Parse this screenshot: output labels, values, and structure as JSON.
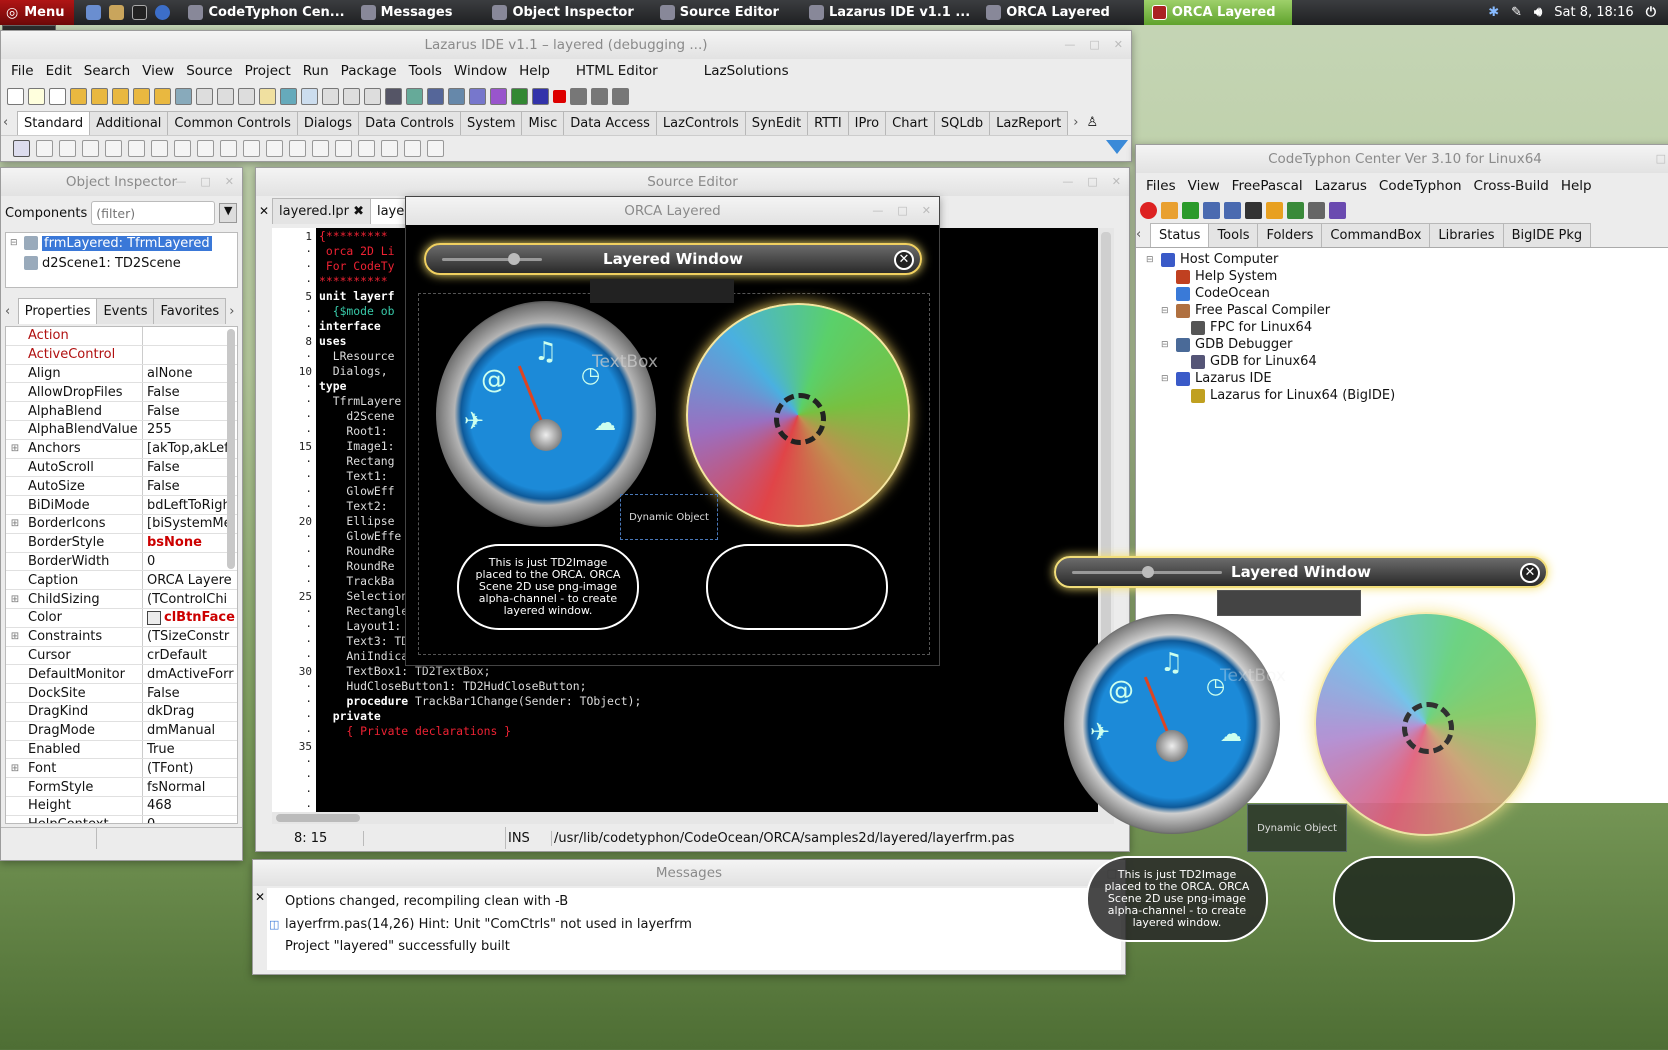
{
  "taskbar": {
    "menu_label": "Menu",
    "tasks": [
      "CodeTyphon Cen...",
      "Messages",
      "Object Inspector",
      "Source Editor",
      "Lazarus IDE v1.1 ...",
      "ORCA Layered",
      "ORCA Layered"
    ],
    "clock": "Sat  8, 18:16"
  },
  "menu_tooltip": "Menu",
  "ide": {
    "title": "Lazarus IDE v1.1 – layered (debugging ...)",
    "menu": [
      "File",
      "Edit",
      "Search",
      "View",
      "Source",
      "Project",
      "Run",
      "Package",
      "Tools",
      "Window",
      "Help",
      "HTML Editor",
      "LazSolutions"
    ],
    "palette_tabs": [
      "Standard",
      "Additional",
      "Common Controls",
      "Dialogs",
      "Data Controls",
      "System",
      "Misc",
      "Data Access",
      "LazControls",
      "SynEdit",
      "RTTI",
      "IPro",
      "Chart",
      "SQLdb",
      "LazReport"
    ]
  },
  "inspector": {
    "title": "Object Inspector",
    "components_label": "Components",
    "filter_placeholder": "(filter)",
    "tree": [
      "frmLayered: TfrmLayered",
      "d2Scene1: TD2Scene"
    ],
    "tabs": [
      "Properties",
      "Events",
      "Favorites"
    ],
    "properties": [
      {
        "name": "Action",
        "value": "",
        "red": true
      },
      {
        "name": "ActiveControl",
        "value": "",
        "red": true
      },
      {
        "name": "Align",
        "value": "alNone"
      },
      {
        "name": "AllowDropFiles",
        "value": "False"
      },
      {
        "name": "AlphaBlend",
        "value": "False"
      },
      {
        "name": "AlphaBlendValue",
        "value": "255"
      },
      {
        "name": "Anchors",
        "value": "[akTop,akLeft",
        "expand": true
      },
      {
        "name": "AutoScroll",
        "value": "False"
      },
      {
        "name": "AutoSize",
        "value": "False"
      },
      {
        "name": "BiDiMode",
        "value": "bdLeftToRigh"
      },
      {
        "name": "BorderIcons",
        "value": "[biSystemMe",
        "expand": true
      },
      {
        "name": "BorderStyle",
        "value": "bsNone",
        "boldred": true
      },
      {
        "name": "BorderWidth",
        "value": "0"
      },
      {
        "name": "Caption",
        "value": "ORCA Layere"
      },
      {
        "name": "ChildSizing",
        "value": "(TControlChi",
        "expand": true
      },
      {
        "name": "Color",
        "value": "clBtnFace",
        "boldred": true,
        "swatch": true
      },
      {
        "name": "Constraints",
        "value": "(TSizeConstr",
        "expand": true
      },
      {
        "name": "Cursor",
        "value": "crDefault"
      },
      {
        "name": "DefaultMonitor",
        "value": "dmActiveForr"
      },
      {
        "name": "DockSite",
        "value": "False"
      },
      {
        "name": "DragKind",
        "value": "dkDrag"
      },
      {
        "name": "DragMode",
        "value": "dmManual"
      },
      {
        "name": "Enabled",
        "value": "True"
      },
      {
        "name": "Font",
        "value": "(TFont)",
        "expand": true
      },
      {
        "name": "FormStyle",
        "value": "fsNormal"
      },
      {
        "name": "Height",
        "value": "468"
      },
      {
        "name": "HelpContext",
        "value": "0"
      }
    ]
  },
  "source_editor": {
    "title": "Source Editor",
    "tabs": [
      "layered.lpr",
      "laye"
    ],
    "gutter": [
      "1",
      "·",
      "·",
      "·",
      "5",
      "·",
      "·",
      "8",
      "·",
      "10",
      "·",
      "·",
      "·",
      "·",
      "15",
      "·",
      "·",
      "·",
      "·",
      "20",
      "·",
      "·",
      "·",
      "·",
      "25",
      "·",
      "·",
      "·",
      "·",
      "30",
      "·",
      "·",
      "·",
      "·",
      "35",
      "·",
      "·",
      "·",
      "·"
    ],
    "status_pos": "8: 15",
    "status_mode": "INS",
    "status_file": "/usr/lib/codetyphon/CodeOcean/ORCA/samples2d/layered/layerfrm.pas"
  },
  "code_lines": [
    {
      "t": "{*********",
      "c": "rd"
    },
    {
      "t": " orca 2D Li",
      "c": "rd"
    },
    {
      "t": " For CodeTy",
      "c": "rd"
    },
    {
      "t": "**********",
      "c": "rd"
    },
    {
      "t": "",
      "c": ""
    },
    {
      "t": "unit layerf",
      "c": "kw"
    },
    {
      "t": "",
      "c": ""
    },
    {
      "t": "  {$mode ob",
      "c": "cm"
    },
    {
      "t": "",
      "c": ""
    },
    {
      "t": "interface",
      "c": "kw"
    },
    {
      "t": "",
      "c": ""
    },
    {
      "t": "uses",
      "c": "kw"
    },
    {
      "t": "  LResource",
      "c": ""
    },
    {
      "t": "  Dialogs, ",
      "c": ""
    },
    {
      "t": "",
      "c": ""
    },
    {
      "t": "type",
      "c": "kw"
    },
    {
      "t": "  TfrmLayere",
      "c": ""
    },
    {
      "t": "    d2Scene",
      "c": ""
    },
    {
      "t": "    Root1:",
      "c": ""
    },
    {
      "t": "    Image1:",
      "c": ""
    },
    {
      "t": "    Rectang",
      "c": ""
    },
    {
      "t": "    Text1:",
      "c": ""
    },
    {
      "t": "    GlowEff",
      "c": ""
    },
    {
      "t": "    Text2:",
      "c": ""
    },
    {
      "t": "    Ellipse",
      "c": ""
    },
    {
      "t": "    GlowEffe",
      "c": ""
    },
    {
      "t": "    RoundRe",
      "c": ""
    },
    {
      "t": "    RoundRe",
      "c": ""
    },
    {
      "t": "    TrackBa",
      "c": ""
    },
    {
      "t": "    Selection1: TD2Selection;",
      "c": ""
    },
    {
      "t": "    Rectangle2: TD2Rectangle;",
      "c": ""
    },
    {
      "t": "    Layout1: TD2Layout;",
      "c": ""
    },
    {
      "t": "    Text3: TD2Text;",
      "c": ""
    },
    {
      "t": "    AniIndicator1: TD2AniIndicator;",
      "c": ""
    },
    {
      "t": "    TextBox1: TD2TextBox;",
      "c": ""
    },
    {
      "t": "    HudCloseButton1: TD2HudCloseButton;",
      "c": ""
    },
    {
      "t": "    procedure TrackBar1Change(Sender: TObject);",
      "c": "proc"
    },
    {
      "t": "  private",
      "c": "kw"
    },
    {
      "t": "    { Private declarations }",
      "c": "rd"
    }
  ],
  "orca": {
    "title": "ORCA Layered",
    "hud_title": "Layered Window",
    "textbox_label": "TextBox",
    "dynamic_label": "Dynamic Object",
    "info_text": "This is just TD2Image placed to the ORCA. ORCA Scene 2D use png-image alpha-channel - to create layered window.",
    "close_glyph": "✕"
  },
  "center": {
    "title": "CodeTyphon Center Ver 3.10 for Linux64",
    "menu": [
      "Files",
      "View",
      "FreePascal",
      "Lazarus",
      "CodeTyphon",
      "Cross-Build",
      "Help"
    ],
    "tabs": [
      "Status",
      "Tools",
      "Folders",
      "CommandBox",
      "Libraries",
      "BigIDE Pkg"
    ],
    "tree": [
      {
        "label": "Host Computer",
        "level": 0
      },
      {
        "label": "Help System",
        "level": 1
      },
      {
        "label": "CodeOcean",
        "level": 1
      },
      {
        "label": "Free Pascal Compiler",
        "level": 1
      },
      {
        "label": "FPC for Linux64",
        "level": 2
      },
      {
        "label": "GDB Debugger",
        "level": 1
      },
      {
        "label": "GDB for Linux64",
        "level": 2
      },
      {
        "label": "Lazarus IDE",
        "level": 1
      },
      {
        "label": "Lazarus for Linux64 (BigIDE)",
        "level": 2
      }
    ]
  },
  "messages": {
    "title": "Messages",
    "lines": [
      "Options changed, recompiling clean with -B",
      "layerfrm.pas(14,26) Hint: Unit \"ComCtrls\" not used in layerfrm",
      "Project \"layered\" successfully built"
    ]
  },
  "colors": {
    "taskbar_active": "#7fbc47",
    "editor_bg": "#000000",
    "hud_glow": "#f0d060",
    "selection": "#3a78d8"
  }
}
